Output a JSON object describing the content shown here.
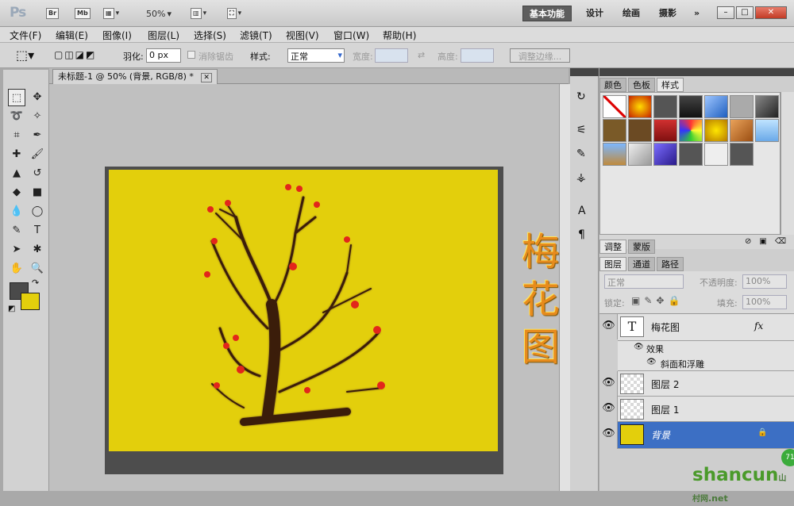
{
  "app": {
    "logo": "Ps",
    "bridge": "Br",
    "minibridge": "Mb",
    "zoom": "50%",
    "workspaces": [
      "基本功能",
      "设计",
      "绘画",
      "摄影"
    ],
    "more": "»",
    "win_min": "–",
    "win_max": "□",
    "win_close": "✕"
  },
  "menu": [
    "文件(F)",
    "编辑(E)",
    "图像(I)",
    "图层(L)",
    "选择(S)",
    "滤镜(T)",
    "视图(V)",
    "窗口(W)",
    "帮助(H)"
  ],
  "options": {
    "feather_label": "羽化:",
    "feather_value": "0 px",
    "antialias_label": "消除锯齿",
    "style_label": "样式:",
    "style_value": "正常",
    "width_label": "宽度:",
    "height_label": "高度:",
    "refine_button": "调整边缘..."
  },
  "document": {
    "tab_title": "未标题-1 @ 50% (背景, RGB/8) *",
    "tab_close": "✕",
    "text": [
      "梅",
      "花",
      "图"
    ]
  },
  "styles_panel": {
    "tabs": [
      "颜色",
      "色板",
      "样式"
    ],
    "active": "样式"
  },
  "adjust_panel": {
    "tabs": [
      "调整",
      "蒙版"
    ]
  },
  "layers_panel": {
    "tabs": [
      "图层",
      "通道",
      "路径"
    ],
    "blend_mode": "正常",
    "opacity_label": "不透明度:",
    "opacity_value": "100%",
    "lock_label": "锁定:",
    "fill_label": "填充:",
    "fill_value": "100%",
    "layers": [
      {
        "name": "梅花图",
        "type": "text",
        "thumb": "T",
        "fx": "fx"
      },
      {
        "name": "效果",
        "type": "effect"
      },
      {
        "name": "斜面和浮雕",
        "type": "effect-item"
      },
      {
        "name": "图层 2",
        "type": "pixel"
      },
      {
        "name": "图层 1",
        "type": "pixel"
      },
      {
        "name": "背景",
        "type": "background",
        "selected": true
      }
    ]
  },
  "watermark": {
    "text": "shancun",
    "suffix": ".net",
    "sub": "山村网",
    "badge": "71"
  },
  "colors": {
    "accent": "#3c6fc4",
    "canvas": "#e3cf0c",
    "foreground": "#4a4a4a",
    "background_color": "#e3cf0c"
  }
}
